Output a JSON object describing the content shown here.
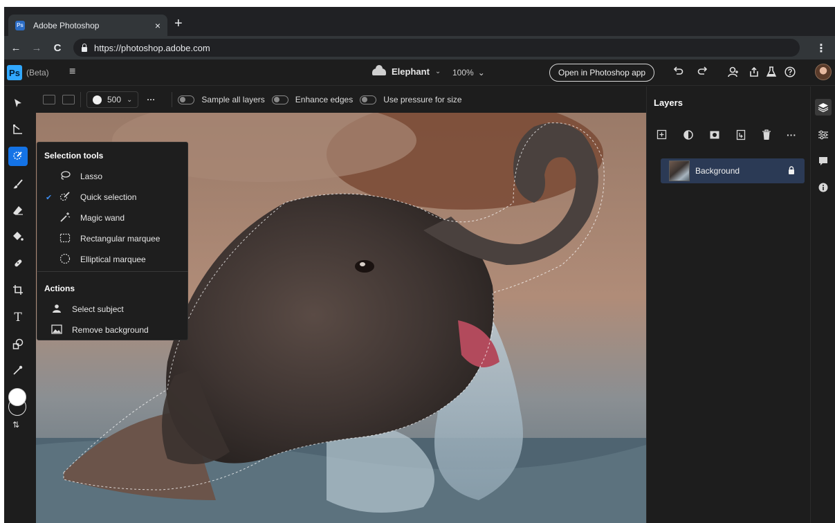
{
  "browser": {
    "tab_title": "Adobe Photoshop",
    "tab_close": "×",
    "new_tab": "+",
    "url": "https://photoshop.adobe.com",
    "back_icon": "←",
    "forward_icon": "→",
    "reload_icon": "C",
    "menu_icon": "⋮"
  },
  "app": {
    "logo": "Ps",
    "badge": "(Beta)",
    "menu_icon": "≡",
    "document_name": "Elephant",
    "zoom": "100%",
    "chevron": "⌄",
    "open_in_app_label": "Open in Photoshop app",
    "icons": [
      "undo-icon",
      "redo-icon",
      "invite-icon",
      "share-icon",
      "beaker-icon",
      "help-icon",
      "avatar"
    ]
  },
  "options_bar": {
    "brush_size": "500",
    "more": "···",
    "toggles": [
      {
        "label": "Sample all layers",
        "on": false
      },
      {
        "label": "Enhance edges",
        "on": false
      },
      {
        "label": "Use pressure for size",
        "on": false
      }
    ]
  },
  "selection_menu": {
    "tools_heading": "Selection tools",
    "tools": [
      {
        "label": "Lasso",
        "icon": "lasso-icon",
        "checked": false
      },
      {
        "label": "Quick selection",
        "icon": "quick-selection-icon",
        "checked": true
      },
      {
        "label": "Magic wand",
        "icon": "magic-wand-icon",
        "checked": false
      },
      {
        "label": "Rectangular marquee",
        "icon": "rectangular-marquee-icon",
        "checked": false
      },
      {
        "label": "Elliptical marquee",
        "icon": "elliptical-marquee-icon",
        "checked": false
      }
    ],
    "actions_heading": "Actions",
    "actions": [
      {
        "label": "Select subject",
        "icon": "select-subject-icon"
      },
      {
        "label": "Remove background",
        "icon": "remove-background-icon"
      }
    ]
  },
  "layers_panel": {
    "title": "Layers",
    "actions": [
      "add-layer-icon",
      "adjustment-icon",
      "mask-icon",
      "clip-icon",
      "delete-icon",
      "more-icon"
    ],
    "layers": [
      {
        "name": "Background",
        "locked": true,
        "selected": true
      }
    ]
  },
  "colors": {
    "accent": "#1473e6",
    "panel_bg": "#1d1d1d",
    "selected_layer": "#2b3a55",
    "ps_blue": "#31a8ff"
  }
}
